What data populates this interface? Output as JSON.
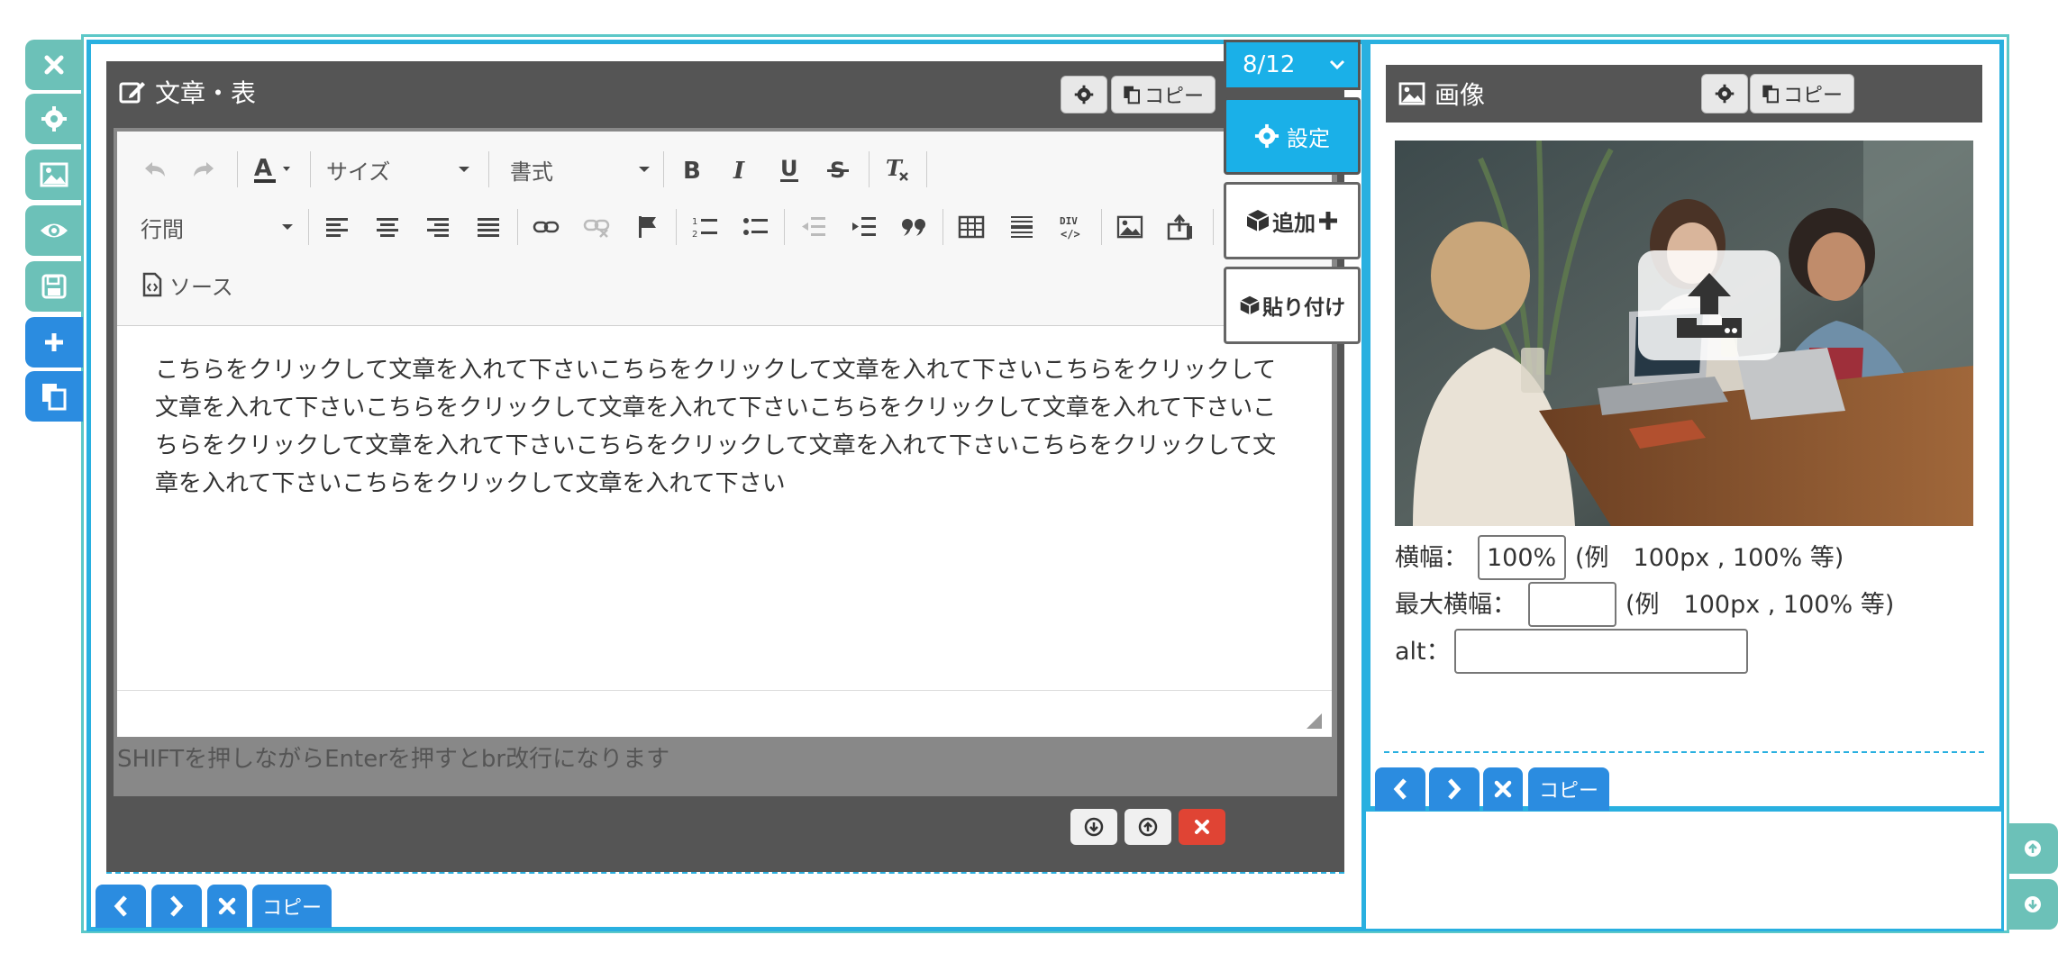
{
  "sidebar": {
    "buttons": [
      {
        "icon": "close-icon",
        "color": "#6cc1b8"
      },
      {
        "icon": "gear-icon",
        "color": "#6cc1b8"
      },
      {
        "icon": "image-icon",
        "color": "#6cc1b8"
      },
      {
        "icon": "eye-icon",
        "color": "#6cc1b8"
      },
      {
        "icon": "save-icon",
        "color": "#6cc1b8"
      },
      {
        "icon": "plus-icon",
        "color": "#2b8ce0"
      },
      {
        "icon": "copy-icon",
        "color": "#2b8ce0"
      }
    ]
  },
  "text_block": {
    "title": "文章・表",
    "copy_label": "コピー",
    "toolbar": {
      "size_label": "サイズ",
      "format_label": "書式",
      "line_height_label": "行間",
      "source_label": "ソース"
    },
    "content": "こちらをクリックして文章を入れて下さいこちらをクリックして文章を入れて下さいこちらをクリックして文章を入れて下さいこちらをクリックして文章を入れて下さいこちらをクリックして文章を入れて下さいこちらをクリックして文章を入れて下さいこちらをクリックして文章を入れて下さいこちらをクリックして文章を入れて下さいこちらをクリックして文章を入れて下さい",
    "hint": "SHIFTを押しながらEnterを押すとbr改行になります"
  },
  "column_selector": {
    "value": "8/12"
  },
  "side_actions": {
    "settings_label": "設定",
    "add_label": "追加",
    "paste_label": "貼り付け"
  },
  "image_block": {
    "title": "画像",
    "copy_label": "コピー",
    "width_label": "横幅：",
    "width_value": "100%",
    "width_example": "(例　100px , 100% 等)",
    "max_width_label": "最大横幅：",
    "max_width_value": "",
    "max_width_example": "(例　100px , 100% 等)",
    "alt_label": "alt：",
    "alt_value": ""
  },
  "nav": {
    "copy_label": "コピー"
  },
  "colors": {
    "teal": "#6cc1b8",
    "blue": "#2b8ce0",
    "frame": "#29b0e0",
    "header": "#555555",
    "delete": "#e04434"
  }
}
